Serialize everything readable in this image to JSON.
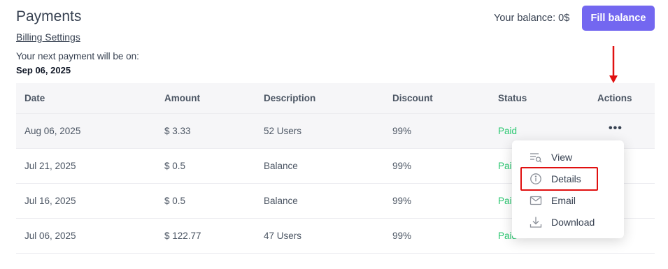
{
  "header": {
    "title": "Payments",
    "billing_link": "Billing Settings",
    "next_payment_label": "Your next payment will be on:",
    "next_payment_date": "Sep 06, 2025",
    "balance_text": "Your balance: 0$",
    "fill_balance_label": "Fill balance"
  },
  "table": {
    "columns": [
      "Date",
      "Amount",
      "Description",
      "Discount",
      "Status",
      "Actions"
    ],
    "rows": [
      {
        "date": "Aug 06, 2025",
        "amount": "$ 3.33",
        "description": "52 Users",
        "discount": "99%",
        "status": "Paid",
        "actions": "•••"
      },
      {
        "date": "Jul 21, 2025",
        "amount": "$ 0.5",
        "description": "Balance",
        "discount": "99%",
        "status": "Paid"
      },
      {
        "date": "Jul 16, 2025",
        "amount": "$ 0.5",
        "description": "Balance",
        "discount": "99%",
        "status": "Paid"
      },
      {
        "date": "Jul 06, 2025",
        "amount": "$ 122.77",
        "description": "47 Users",
        "discount": "99%",
        "status": "Paid"
      }
    ]
  },
  "actions_menu": {
    "items": [
      {
        "label": "View",
        "icon": "view-list-search-icon"
      },
      {
        "label": "Details",
        "icon": "info-circle-icon"
      },
      {
        "label": "Email",
        "icon": "envelope-icon"
      },
      {
        "label": "Download",
        "icon": "download-icon"
      }
    ]
  },
  "colors": {
    "accent": "#7367f0",
    "paid": "#28c76f",
    "annotation": "#e01010",
    "table_header_bg": "#f6f6f8"
  }
}
